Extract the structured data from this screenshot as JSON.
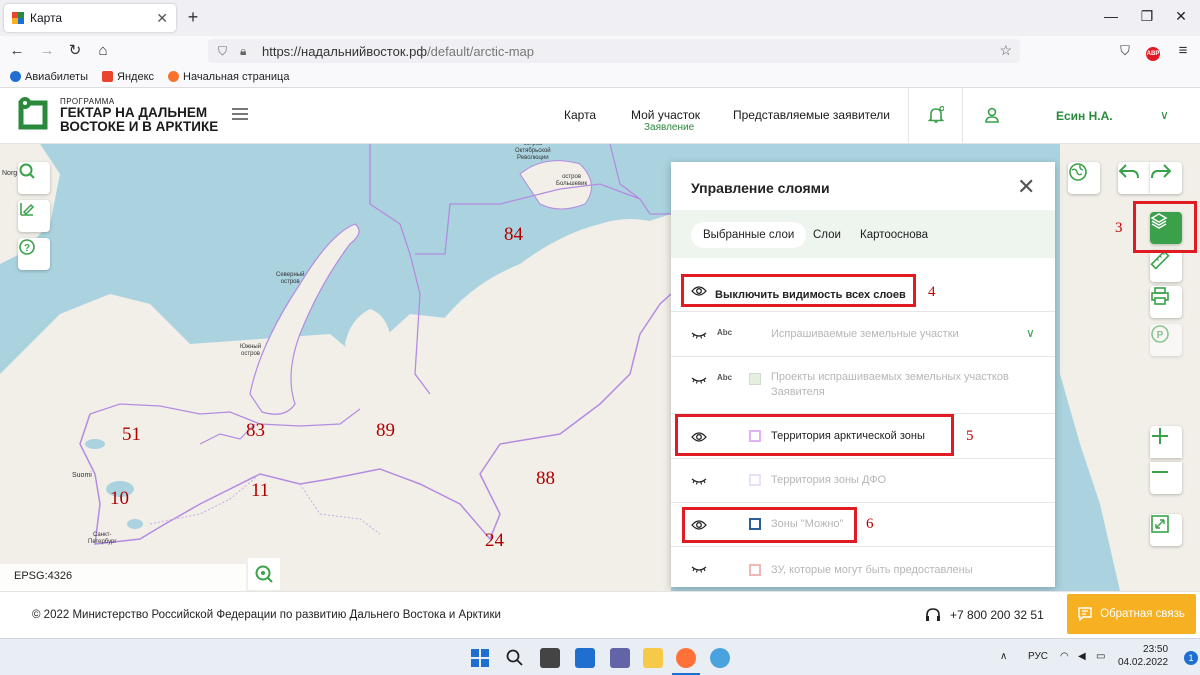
{
  "browser": {
    "tab_title": "Карта",
    "url_host": "https://надальнийвосток.рф",
    "url_path": "/default/arctic-map",
    "bookmarks": [
      "Авиабилеты",
      "Яндекс",
      "Начальная страница"
    ]
  },
  "header": {
    "logo_small": "ПРОГРАММА",
    "logo_big": "ГЕКТАР НА ДАЛЬНЕМ ВОСТОКЕ И В АРКТИКЕ",
    "nav": {
      "map": "Карта",
      "my_plot": "Мой участок",
      "my_plot_sub": "Заявление",
      "representatives": "Представляемые заявители"
    },
    "user_name": "Есин Н.А."
  },
  "map": {
    "region_numbers": [
      "84",
      "51",
      "83",
      "89",
      "10",
      "11",
      "88",
      "24"
    ],
    "labels": {
      "severny": "Северный\nостров",
      "yuzhny": "Южный\nостров",
      "oktyabrskoy": "остров\nОктябрьской\nРеволюции",
      "bolshevik": "остров\nБольшевик",
      "norge": "Norg",
      "suomi": "Suomi",
      "spb": "Санкт-\nПетербург"
    },
    "projection": "EPSG:4326"
  },
  "layers_panel": {
    "title": "Управление слоями",
    "tabs": [
      "Выбранные слои",
      "Слои",
      "Картооснова"
    ],
    "active_tab": "Выбранные слои",
    "toggle_all": "Выключить видимость всех слоев",
    "abc": "Abc",
    "rows": [
      {
        "label": "Испрашиваемые земельные участки",
        "visible": false
      },
      {
        "label": "Проекты испрашиваемых земельных участков Заявителя",
        "visible": false
      },
      {
        "label": "Территория арктической зоны",
        "visible": true
      },
      {
        "label": "Территория зоны ДФО",
        "visible": false
      },
      {
        "label": "Зоны \"Можно\"",
        "visible": true
      },
      {
        "label": "ЗУ, которые могут быть предоставлены",
        "visible": false
      }
    ]
  },
  "annotations": [
    "3",
    "4",
    "5",
    "6"
  ],
  "footer": {
    "copyright": "© 2022 Министерство Российской Федерации по развитию Дальнего Востока и Арктики",
    "phone": "+7 800 200 32 51",
    "feedback": "Обратная связь"
  },
  "taskbar": {
    "lang": "РУС",
    "time": "23:50",
    "date": "04.02.2022",
    "notifications": "1"
  },
  "colors": {
    "brand_green": "#3aa14a",
    "annotation_red": "#e01b24",
    "feedback_orange": "#f7b021",
    "sea": "#aad3df",
    "land": "#f2efe9",
    "arctic_border": "#b48be0"
  }
}
